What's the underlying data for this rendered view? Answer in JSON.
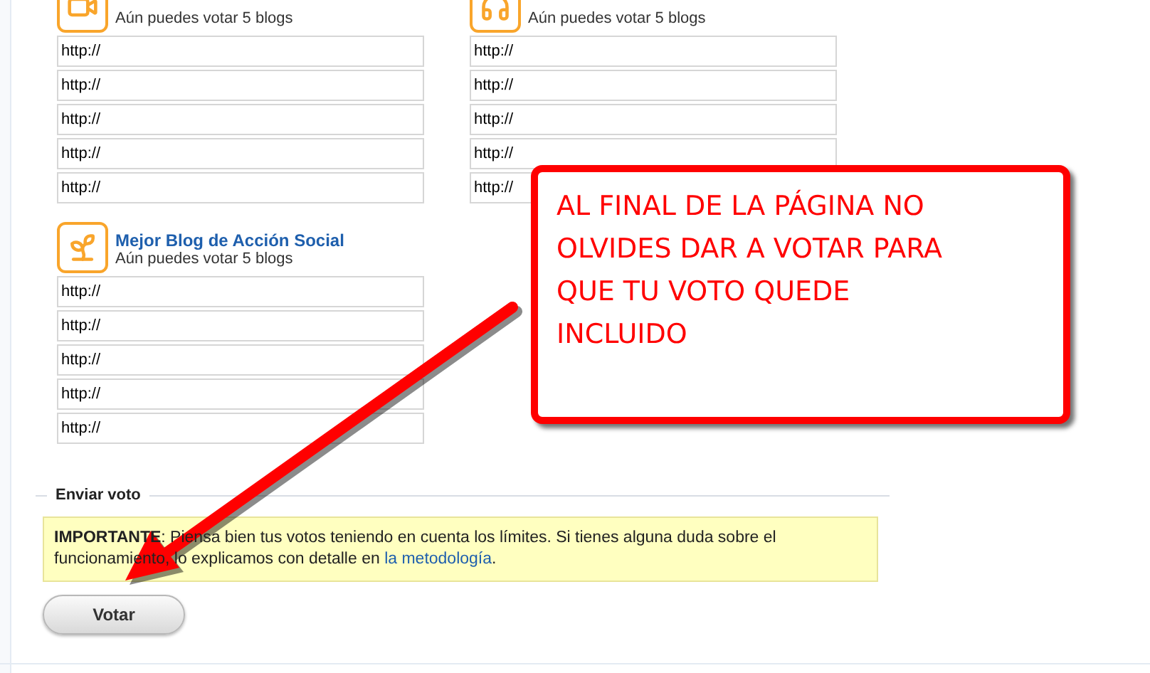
{
  "categories": [
    {
      "subtitle": "Aún puedes votar 5 blogs",
      "fields": [
        "http://",
        "http://",
        "http://",
        "http://",
        "http://"
      ]
    },
    {
      "subtitle": "Aún puedes votar 5 blogs",
      "fields": [
        "http://",
        "http://",
        "http://",
        "http://",
        "http://"
      ]
    },
    {
      "title": "Mejor Blog de Acción Social",
      "subtitle": "Aún puedes votar 5 blogs",
      "fields": [
        "http://",
        "http://",
        "http://",
        "http://",
        "http://"
      ]
    }
  ],
  "submit_section": {
    "legend": "Enviar voto",
    "notice": "**IMPORTANTE**: Piensa bien tus votos teniendo en cuenta los límites. Si tienes alguna duda sobre el funcionamiento, lo explicamos con detalle en",
    "notice_link": "la metodología",
    "notice_end": ".",
    "button": "Votar"
  },
  "callout": {
    "text": "AL FINAL DE LA PÁGINA NO OLVIDES DAR A VOTAR PARA QUE TU VOTO QUEDE INCLUIDO"
  }
}
